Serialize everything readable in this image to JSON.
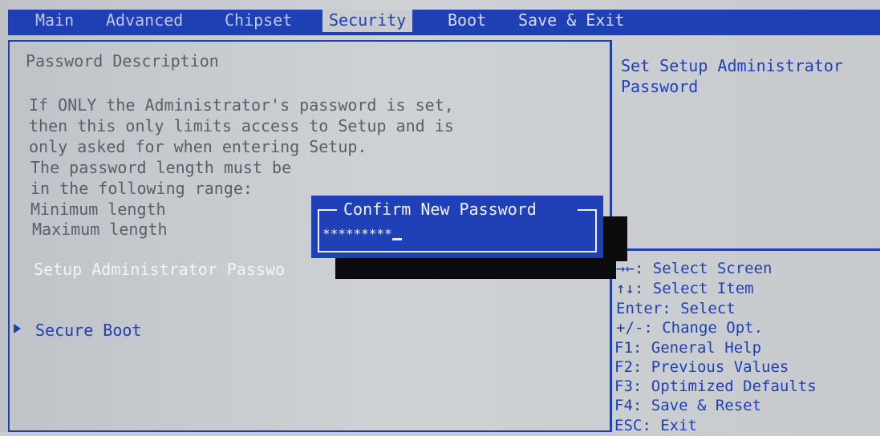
{
  "menu": {
    "tabs": [
      {
        "label": "Main"
      },
      {
        "label": "Advanced"
      },
      {
        "label": "Chipset"
      },
      {
        "label": "Security"
      },
      {
        "label": "Boot"
      },
      {
        "label": "Save & Exit"
      }
    ]
  },
  "left": {
    "heading": "Password Description",
    "desc_lines": [
      "If ONLY the Administrator's password is set,",
      "then this only limits access to Setup and is",
      "only asked for when entering Setup.",
      "The password length must be",
      "in the following range:",
      "Minimum length",
      "Maximum length"
    ],
    "admin_password_label": "Setup Administrator Passwo",
    "secure_boot_label": "Secure Boot"
  },
  "help": {
    "line1": "Set Setup Administrator",
    "line2": "Password"
  },
  "keys": [
    "→←: Select Screen",
    "↑↓: Select Item",
    "Enter: Select",
    "+/-: Change Opt.",
    "F1: General Help",
    "F2: Previous Values",
    "F3: Optimized Defaults",
    "F4: Save & Reset",
    "ESC: Exit"
  ],
  "dialog": {
    "title": "Confirm New Password",
    "value": "*********"
  },
  "colors": {
    "bios_blue": "#1f3fb5",
    "background": "#c8cbcf",
    "text_white": "#f2f3f5"
  }
}
